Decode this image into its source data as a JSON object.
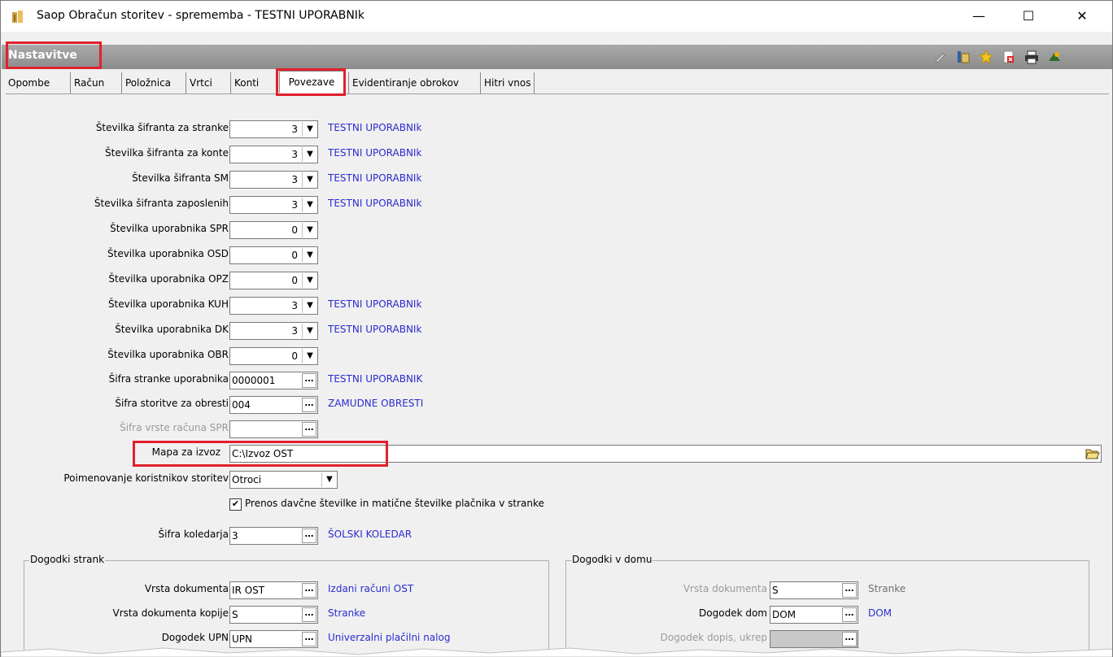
{
  "window": {
    "title": "Saop Obračun storitev - sprememba - TESTNI UPORABNIk",
    "minimize": "—",
    "maximize": "☐",
    "close": "✕"
  },
  "section": {
    "title": "Nastavitve"
  },
  "toolbar_icons": [
    "edit-icon",
    "columns-icon",
    "star-icon",
    "delete-icon",
    "print-icon",
    "exit-icon"
  ],
  "tabs": [
    {
      "label": "Opombe"
    },
    {
      "label": "Račun"
    },
    {
      "label": "Položnica"
    },
    {
      "label": "Vrtci"
    },
    {
      "label": "Konti"
    },
    {
      "label": "Povezave",
      "active": true
    },
    {
      "label": "Evidentiranje obrokov"
    },
    {
      "label": "Hitri vnos"
    }
  ],
  "rows": [
    {
      "label": "Številka šifranta za stranke",
      "value": "3",
      "link": "TESTNI UPORABNIk"
    },
    {
      "label": "Številka šifranta za konte",
      "value": "3",
      "link": "TESTNI UPORABNIk"
    },
    {
      "label": "Številka šifranta SM",
      "value": "3",
      "link": "TESTNI UPORABNIk"
    },
    {
      "label": "Številka šifranta zaposlenih",
      "value": "3",
      "link": "TESTNI UPORABNIk"
    },
    {
      "label": "Številka uporabnika SPR",
      "value": "0",
      "link": ""
    },
    {
      "label": "Številka uporabnika OSD",
      "value": "0",
      "link": ""
    },
    {
      "label": "Številka uporabnika OPZ",
      "value": "0",
      "link": ""
    },
    {
      "label": "Številka uporabnika KUH",
      "value": "3",
      "link": "TESTNI UPORABNIk"
    },
    {
      "label": "Številka uporabnika DK",
      "value": "3",
      "link": "TESTNI UPORABNIk"
    },
    {
      "label": "Številka uporabnika OBR",
      "value": "0",
      "link": ""
    }
  ],
  "lookups": [
    {
      "label": "Šifra stranke uporabnika",
      "value": "0000001",
      "link": "TESTNI UPORABNIK"
    },
    {
      "label": "Šifra storitve za obresti",
      "value": "004",
      "link": "ZAMUDNE OBRESTI"
    },
    {
      "label": "Šifra vrste računa SPR",
      "value": "",
      "link": ""
    }
  ],
  "export_folder": {
    "label": "Mapa za izvoz",
    "value": "C:\\Izvoz OST"
  },
  "naming": {
    "label": "Poimenovanje koristnikov storitev",
    "value": "Otroci"
  },
  "checkbox": {
    "label": "Prenos davčne številke in matične številke plačnika v stranke",
    "checked": "✔"
  },
  "calendar": {
    "label": "Šifra koledarja",
    "value": "3",
    "link": "ŠOLSKI KOLEDAR"
  },
  "group_left": {
    "title": "Dogodki strank",
    "rows": [
      {
        "label": "Vrsta dokumenta",
        "value": "IR OST",
        "link": "Izdani računi OST"
      },
      {
        "label": "Vrsta dokumenta kopije",
        "value": "S",
        "link": "Stranke"
      },
      {
        "label": "Dogodek UPN",
        "value": "UPN",
        "link": "Univerzalni plačilni nalog"
      }
    ]
  },
  "group_right": {
    "title": "Dogodki v domu",
    "rows": [
      {
        "label": "Vrsta dokumenta",
        "value": "S",
        "link": "Stranke"
      },
      {
        "label": "Dogodek dom",
        "value": "DOM",
        "link": "DOM"
      },
      {
        "label": "Dogodek dopis, ukrep",
        "value": "",
        "link": ""
      }
    ]
  },
  "ellipsis": "…",
  "dropdown_arrow": "▼"
}
